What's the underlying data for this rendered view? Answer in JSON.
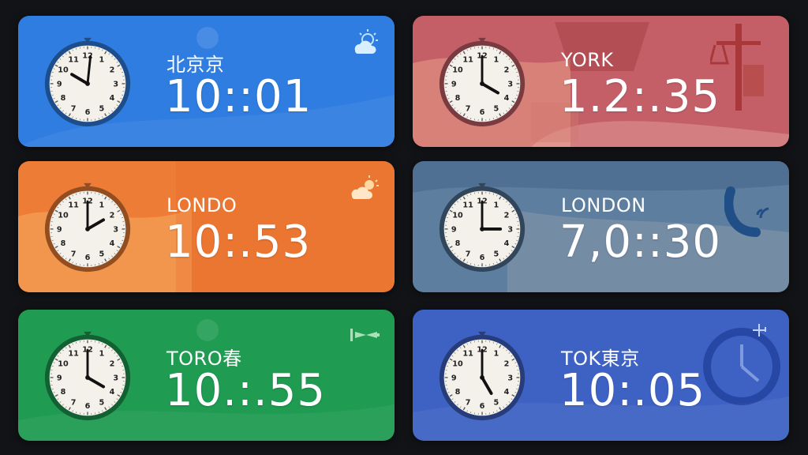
{
  "cards": [
    {
      "city": "北京京",
      "time": "10::01",
      "color": "#2f7de0",
      "icon": "partly-cloudy-icon",
      "clock": {
        "hour": 10,
        "minute": 1
      }
    },
    {
      "city": "YORK",
      "time": "1.2:.35",
      "color": "#c45f68",
      "icon": "scales-landmark-icon",
      "clock": {
        "hour": 4,
        "minute": 0
      }
    },
    {
      "city": "LONDO",
      "time": "10:.53",
      "color": "#ec7c36",
      "icon": "sunny-cloud-icon",
      "clock": {
        "hour": 2,
        "minute": 0
      }
    },
    {
      "city": "LONDON",
      "time": "7,0::30",
      "color": "#4f6f93",
      "icon": "signal-arc-icon",
      "clock": {
        "hour": 3,
        "minute": 0
      }
    },
    {
      "city": "TORO春",
      "time": "10.:.55",
      "color": "#1f9b52",
      "icon": "weathervane-icon",
      "clock": {
        "hour": 4,
        "minute": 0
      }
    },
    {
      "city": "TOK東京",
      "time": "10:.05",
      "color": "#3e62c4",
      "icon": "clock-weather-icon",
      "clock": {
        "hour": 5,
        "minute": 0
      }
    }
  ]
}
